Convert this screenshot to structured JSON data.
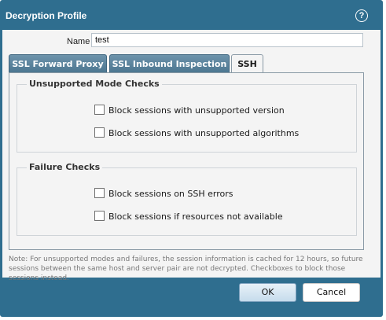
{
  "dialog": {
    "title": "Decryption Profile",
    "help_icon": "help-icon",
    "help_glyph": "?"
  },
  "form": {
    "name_label": "Name",
    "name_value": "test"
  },
  "tabs": [
    {
      "label": "SSL Forward Proxy",
      "active": false
    },
    {
      "label": "SSL Inbound Inspection",
      "active": false
    },
    {
      "label": "SSH",
      "active": true
    }
  ],
  "unsupported": {
    "title": "Unsupported Mode Checks",
    "items": [
      {
        "label": "Block sessions with unsupported version",
        "checked": false
      },
      {
        "label": "Block sessions with unsupported algorithms",
        "checked": false
      }
    ]
  },
  "failure": {
    "title": "Failure Checks",
    "items": [
      {
        "label": "Block sessions on SSH errors",
        "checked": false
      },
      {
        "label": "Block sessions if resources not available",
        "checked": false
      }
    ]
  },
  "note": "Note: For unsupported modes and failures, the session information is cached for 12 hours, so future sessions between the same host and server pair are not decrypted. Checkboxes to block those sessions instead.",
  "buttons": {
    "ok": "OK",
    "cancel": "Cancel"
  },
  "colors": {
    "titlebar": "#2f6e8f",
    "tab_inactive": "#5a8299",
    "panel_bg": "#f4f4f4"
  }
}
